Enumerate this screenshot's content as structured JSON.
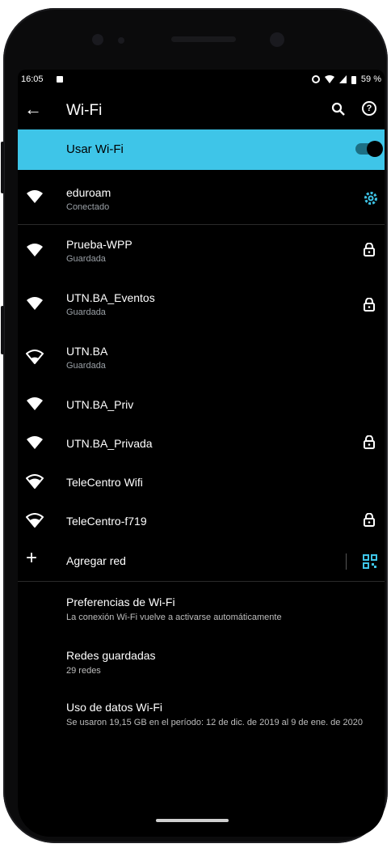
{
  "status_bar": {
    "time": "16:05",
    "battery": "59 %"
  },
  "app_bar": {
    "title": "Wi-Fi"
  },
  "master_toggle": {
    "label": "Usar Wi-Fi",
    "enabled": true
  },
  "networks": [
    {
      "name": "eduroam",
      "status": "Conectado",
      "locked": false,
      "action": "gear-icon"
    },
    {
      "name": "Prueba-WPP",
      "status": "Guardada",
      "locked": true
    },
    {
      "name": "UTN.BA_Eventos",
      "status": "Guardada",
      "locked": true
    },
    {
      "name": "UTN.BA",
      "status": "Guardada",
      "locked": false
    },
    {
      "name": "UTN.BA_Priv",
      "status": "",
      "locked": false
    },
    {
      "name": "UTN.BA_Privada",
      "status": "",
      "locked": true
    },
    {
      "name": "TeleCentro Wifi",
      "status": "",
      "locked": false
    },
    {
      "name": "TeleCentro-f719",
      "status": "",
      "locked": true
    }
  ],
  "add_network": {
    "label": "Agregar red"
  },
  "preferences": [
    {
      "title": "Preferencias de Wi-Fi",
      "subtitle": "La conexión Wi-Fi vuelve a activarse automáticamente"
    },
    {
      "title": "Redes guardadas",
      "subtitle": "29 redes"
    },
    {
      "title": "Uso de datos Wi-Fi",
      "subtitle": "Se usaron 19,15 GB en el período: 12 de dic. de 2019 al 9 de ene. de 2020"
    }
  ],
  "colors": {
    "accent": "#3ec5e8",
    "background": "#000000",
    "text": "#ffffff",
    "secondary_text": "#9aa0a6"
  }
}
